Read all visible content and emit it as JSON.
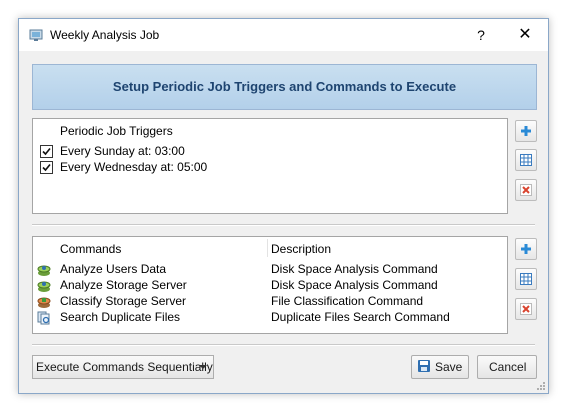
{
  "window": {
    "title": "Weekly Analysis Job",
    "help_glyph": "?",
    "close_glyph": "✕"
  },
  "header": {
    "text": "Setup Periodic Job Triggers and Commands to Execute"
  },
  "triggers": {
    "column": "Periodic Job Triggers",
    "rows": [
      {
        "label": "Every Sunday at: 03:00",
        "checked": true
      },
      {
        "label": "Every Wednesday at: 05:00",
        "checked": true
      }
    ]
  },
  "commands": {
    "columns": [
      "Commands",
      "Description"
    ],
    "rows": [
      {
        "command": "Analyze Users Data",
        "description": "Disk Space Analysis Command",
        "icon": "disk-analysis-icon"
      },
      {
        "command": "Analyze Storage Server",
        "description": "Disk Space Analysis Command",
        "icon": "disk-analysis-icon"
      },
      {
        "command": "Classify Storage Server",
        "description": "File Classification Command",
        "icon": "file-classification-icon"
      },
      {
        "command": "Search Duplicate Files",
        "description": "Duplicate Files Search Command",
        "icon": "duplicate-search-icon"
      }
    ]
  },
  "footer": {
    "mode_select": "Execute Commands Sequentially",
    "save_label": "Save",
    "cancel_label": "Cancel"
  },
  "colors": {
    "banner_text": "#1e4470",
    "add": "#2a8ad6",
    "delete": "#d9442f"
  }
}
